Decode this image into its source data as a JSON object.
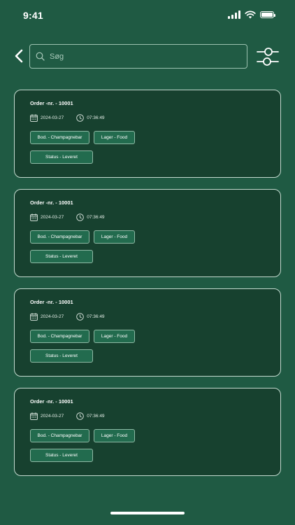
{
  "status_bar": {
    "time": "9:41"
  },
  "search": {
    "placeholder": "Søg",
    "value": ""
  },
  "orders": [
    {
      "title": "Order -nr. - 10001",
      "date": "2024-03-27",
      "time": "07:36:49",
      "bod": "Bod. - Champagnebar",
      "lager": "Lager - Food",
      "status": "Status - Leveret"
    },
    {
      "title": "Order -nr. - 10001",
      "date": "2024-03-27",
      "time": "07:36:49",
      "bod": "Bod. - Champagnebar",
      "lager": "Lager - Food",
      "status": "Status - Leveret"
    },
    {
      "title": "Order -nr. - 10001",
      "date": "2024-03-27",
      "time": "07:36:49",
      "bod": "Bod. - Champagnebar",
      "lager": "Lager - Food",
      "status": "Status - Leveret"
    },
    {
      "title": "Order -nr. - 10001",
      "date": "2024-03-27",
      "time": "07:36:49",
      "bod": "Bod. - Champagnebar",
      "lager": "Lager - Food",
      "status": "Status - Leveret"
    }
  ],
  "icons": {
    "back": "chevron-left-icon",
    "search": "search-icon",
    "filter": "sliders-icon",
    "date": "calendar-icon",
    "time": "clock-icon"
  },
  "colors": {
    "background": "#1f5a43",
    "card": "#17412f",
    "chip": "#226b4e",
    "border": "#c4dacf"
  }
}
